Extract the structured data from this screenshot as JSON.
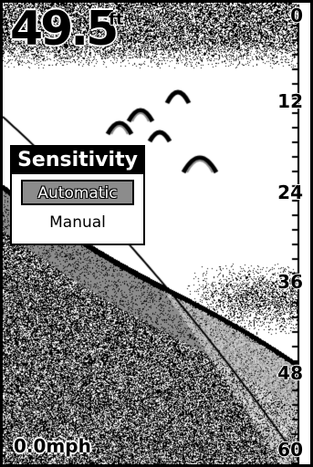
{
  "display": {
    "depth_value": "49.5",
    "depth_unit": "ft",
    "speed": "0.0mph"
  },
  "depth_scale": {
    "labels": [
      "0",
      "12",
      "24",
      "36",
      "48",
      "60"
    ]
  },
  "sensitivity_menu": {
    "title": "Sensitivity",
    "options": [
      {
        "label": "Automatic",
        "selected": true
      },
      {
        "label": "Manual",
        "selected": false
      }
    ]
  },
  "colors": {
    "background": "#ffffff",
    "foreground": "#000000",
    "bottom_gray": "#8c8c8c",
    "selection_gray": "#8c8c8c"
  },
  "icons": [
    "fish-arch-icon"
  ]
}
